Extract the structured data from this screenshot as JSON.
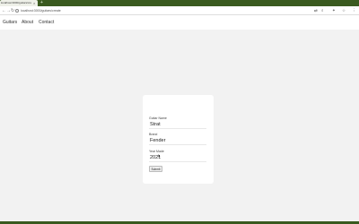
{
  "browser": {
    "tab_title": "localhost:3000/guitars/create",
    "tab_close": "×",
    "new_tab": "+",
    "url": "localhost:3000/guitars/create"
  },
  "nav": {
    "links": [
      "Guitars",
      "About",
      "Contact"
    ]
  },
  "form": {
    "name_label": "Guitar Name",
    "name_value": "Strat",
    "brand_label": "Brand",
    "brand_value": "Fender",
    "year_label": "Year Made",
    "year_value": "2021",
    "submit_label": "Submit"
  },
  "icons": {
    "back": "back-arrow-icon",
    "forward": "forward-arrow-icon",
    "reload": "reload-icon",
    "bookmark": "star-icon",
    "extensions": "puzzle-icon",
    "profile": "account-icon",
    "menu": "more-icon"
  },
  "colors": {
    "chrome_accent": "#3a5a1f",
    "page_background": "#f2f2f2",
    "card_background": "#ffffff"
  }
}
